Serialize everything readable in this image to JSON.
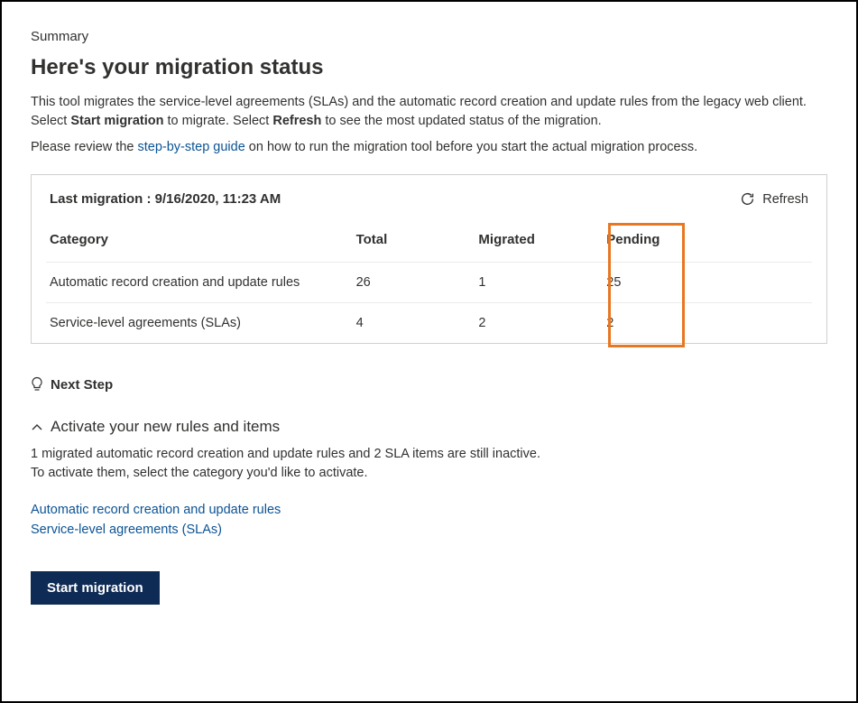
{
  "summary_label": "Summary",
  "page_title": "Here's your migration status",
  "intro": {
    "part1": "This tool migrates the service-level agreements (SLAs) and the automatic record creation and update rules from the legacy web client. Select ",
    "bold1": "Start migration",
    "part2": " to migrate. Select ",
    "bold2": "Refresh",
    "part3": " to see the most updated status of the migration."
  },
  "review": {
    "part1": "Please review the ",
    "link": "step-by-step guide",
    "part2": " on how to run the migration tool before you start the actual migration process."
  },
  "panel": {
    "last_migration_label": "Last migration : 9/16/2020, 11:23 AM",
    "refresh_label": "Refresh",
    "columns": {
      "category": "Category",
      "total": "Total",
      "migrated": "Migrated",
      "pending": "Pending"
    },
    "rows": [
      {
        "category": "Automatic record creation and update rules",
        "total": "26",
        "migrated": "1",
        "pending": "25"
      },
      {
        "category": "Service-level agreements (SLAs)",
        "total": "4",
        "migrated": "2",
        "pending": "2"
      }
    ]
  },
  "next_step_label": "Next Step",
  "activate": {
    "header": "Activate your new rules and items",
    "line1": "1 migrated automatic record creation and update rules and 2 SLA items are still inactive.",
    "line2": "To activate them, select the category you'd like to activate."
  },
  "category_links": {
    "arc": "Automatic record creation and update rules",
    "sla": "Service-level agreements (SLAs)"
  },
  "start_button": "Start migration"
}
